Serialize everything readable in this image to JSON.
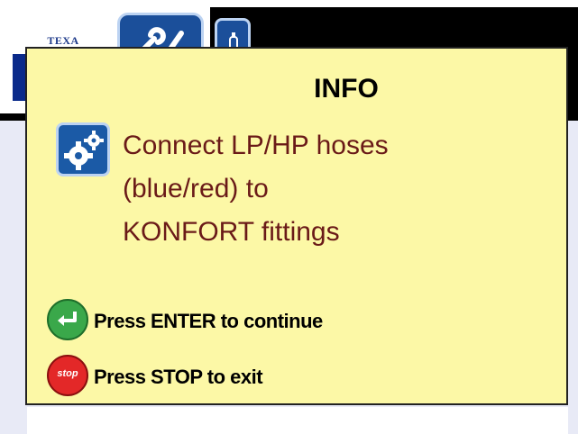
{
  "header": {
    "logo_text": "TEXA"
  },
  "dialog": {
    "title": "INFO",
    "message_lines": [
      "Connect LP/HP hoses",
      "(blue/red) to",
      "KONFORT fittings"
    ],
    "icon": "gears-icon",
    "actions": {
      "enter_label": "Press ENTER to continue",
      "stop_label": "Press STOP to exit",
      "stop_button_text": "stop"
    }
  },
  "colors": {
    "dialog_background": "#fcf8a6",
    "message_text": "#6a1a18",
    "header_blue": "#1b4f9a",
    "enter_green": "#3aa84a",
    "stop_red": "#e32828"
  }
}
